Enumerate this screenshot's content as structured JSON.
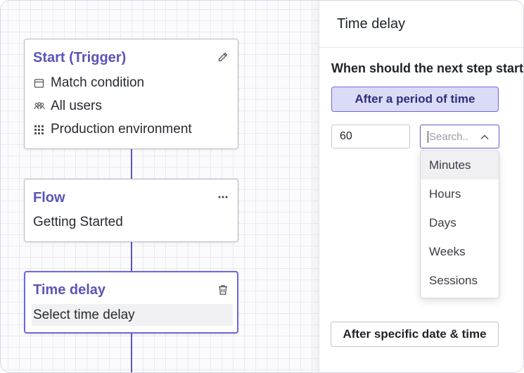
{
  "flow_nodes": {
    "start": {
      "title": "Start (Trigger)",
      "rows": [
        "Match condition",
        "All users",
        "Production environment"
      ]
    },
    "flow": {
      "title": "Flow",
      "subtitle": "Getting Started"
    },
    "time_delay": {
      "title": "Time delay",
      "select_placeholder": "Select time delay"
    }
  },
  "panel": {
    "title": "Time delay",
    "question": "When should the next step start?",
    "period_button": "After a period of time",
    "amount_value": "60",
    "unit_search_placeholder": "Search..",
    "unit_options": [
      "Minutes",
      "Hours",
      "Days",
      "Weeks",
      "Sessions"
    ],
    "specific_button": "After specific date & time"
  },
  "icons": {
    "edit": "pencil-icon",
    "condition": "window-icon",
    "users": "users-icon",
    "environment": "grid-icon",
    "more": "ellipsis-icon",
    "delete": "trash-icon",
    "dropdown": "chevron-up-icon"
  },
  "colors": {
    "accent": "#5a54b8",
    "selected_border": "#6d68d8",
    "active_button_bg": "#dcdbf7"
  }
}
